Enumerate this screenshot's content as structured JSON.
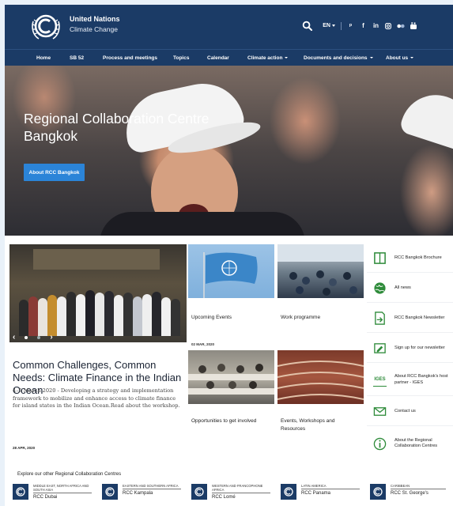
{
  "header": {
    "org_name": "United Nations",
    "org_sub": "Climate Change",
    "language": "EN",
    "social": [
      "twitter-icon",
      "facebook-icon",
      "linkedin-icon",
      "instagram-icon",
      "flickr-icon",
      "youtube-icon"
    ]
  },
  "nav": {
    "items": [
      {
        "label": "Home"
      },
      {
        "label": "SB 52"
      },
      {
        "label": "Process and meetings"
      },
      {
        "label": "Topics"
      },
      {
        "label": "Calendar"
      },
      {
        "label": "Climate action"
      },
      {
        "label": "Documents and decisions"
      },
      {
        "label": "About us"
      }
    ]
  },
  "hero": {
    "title": "Regional Collaboration Centre Bangkok",
    "button": "About RCC Bangkok"
  },
  "feature": {
    "title": "Common Challenges, Common Needs: Climate Finance in the Indian Ocean",
    "text": "4–5 March 2020 - Developing a strategy and implementation framework to mobilize and enhance access to climate finance for island states in the Indian Ocean.Read about the workshop.",
    "date": "28 APR, 2020"
  },
  "tiles": [
    {
      "title": "Upcoming Events",
      "date": "02 MAR, 2020"
    },
    {
      "title": "Work programme",
      "date": ""
    },
    {
      "title": "Opportunities to get involved",
      "date": ""
    },
    {
      "title": "Events, Workshops and Resources",
      "date": ""
    }
  ],
  "side_links": [
    {
      "label": "RCC Bangkok Brochure",
      "icon": "brochure-icon"
    },
    {
      "label": "All news",
      "icon": "globe-icon"
    },
    {
      "label": "RCC Bangkok Newsletter",
      "icon": "newsletter-icon"
    },
    {
      "label": "Sign up for our newsletter",
      "icon": "signup-icon"
    },
    {
      "label": "About RCC Bangkok's host partner - IGES",
      "icon": "iges-logo",
      "logo_text": "IGES"
    },
    {
      "label": "Contact us",
      "icon": "envelope-icon"
    },
    {
      "label": "About the Regional Collaboration Centres",
      "icon": "info-icon"
    }
  ],
  "explore": {
    "heading": "Explore our other Regional Collaboration Centres",
    "centres": [
      {
        "region": "MIDDLE EAST, NORTH AFRICA AND SOUTH ASIA",
        "name": "RCC Dubai"
      },
      {
        "region": "EASTERN AND SOUTHERN AFRICA",
        "name": "RCC Kampala"
      },
      {
        "region": "WESTERN AND FRANCOPHONE AFRICA",
        "name": "RCC Lomé"
      },
      {
        "region": "LATIN AMERICA",
        "name": "RCC Panama"
      },
      {
        "region": "CARIBBEAN",
        "name": "RCC St. George's"
      }
    ]
  },
  "colors": {
    "header_bg": "#1b3b66",
    "accent": "#2b84d8",
    "icon_green": "#2e8b3a"
  }
}
